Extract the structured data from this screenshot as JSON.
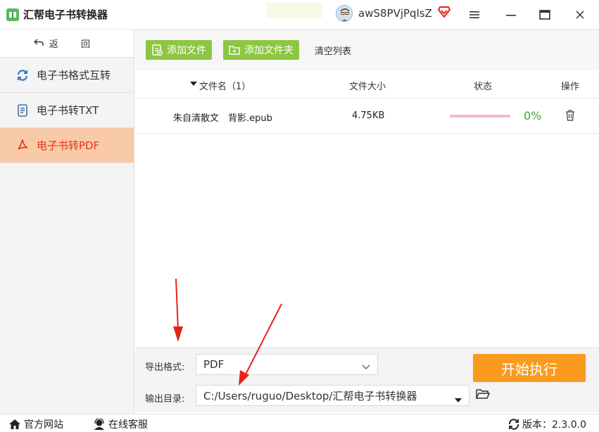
{
  "app": {
    "title": "汇帮电子书转换器",
    "username": "awS8PVjPqlsZ"
  },
  "window_controls": {
    "menu": "≡",
    "maximize": "□",
    "close": "✕"
  },
  "sidebar": {
    "back_label": "返 回",
    "items": [
      {
        "label": "电子书格式互转",
        "icon": "refresh-icon",
        "active": false
      },
      {
        "label": "电子书转TXT",
        "icon": "document-icon",
        "active": false
      },
      {
        "label": "电子书转PDF",
        "icon": "pdf-icon",
        "active": true
      }
    ]
  },
  "toolbar": {
    "add_file_label": "添加文件",
    "add_folder_label": "添加文件夹",
    "clear_label": "清空列表"
  },
  "table": {
    "headers": {
      "name": "文件名（1）",
      "size": "文件大小",
      "status": "状态",
      "action": "操作"
    },
    "rows": [
      {
        "name": "朱自清散文　背影.epub",
        "size": "4.75KB",
        "progress_percent": 0,
        "status_text": "0%"
      }
    ]
  },
  "settings": {
    "format_label": "导出格式:",
    "format_value": "PDF",
    "output_label": "输出目录:",
    "output_value": "C:/Users/ruguo/Desktop/汇帮电子书转换器",
    "start_label": "开始执行"
  },
  "footer": {
    "website_label": "官方网站",
    "support_label": "在线客服",
    "version_label": "版本：2.3.0.0"
  },
  "colors": {
    "accent_green": "#8dc641",
    "active_bg": "#f9caa7",
    "active_text": "#e8341a",
    "start_orange": "#fa9a1e",
    "progress_pink": "#f5b8c8",
    "percent_green": "#3fa535",
    "annotation_red": "#e5231b"
  }
}
